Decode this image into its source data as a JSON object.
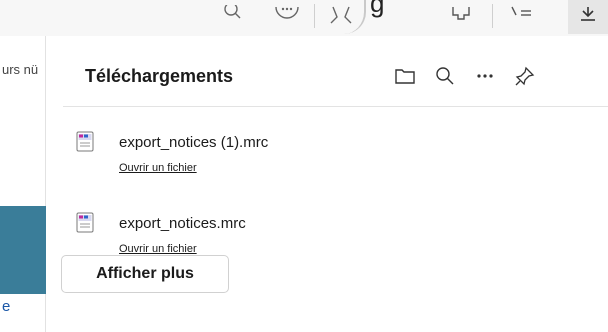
{
  "toolbar": {
    "tooltip_text": "g",
    "icons": [
      "search-icon",
      "more-emoji-icon",
      "favorite-icon",
      "extensions-icon",
      "favorites-list-icon",
      "download-icon"
    ]
  },
  "left_page": {
    "label": "urs nü",
    "link": "e",
    "bar_color": "#3a7d99"
  },
  "downloads_panel": {
    "title": "Téléchargements",
    "actions": [
      "folder-icon",
      "search-icon",
      "more-icon",
      "pin-icon"
    ],
    "items": [
      {
        "name": "export_notices (1).mrc",
        "action": "Ouvrir un fichier"
      },
      {
        "name": "export_notices.mrc",
        "action": "Ouvrir un fichier"
      }
    ],
    "more_button": "Afficher plus"
  }
}
